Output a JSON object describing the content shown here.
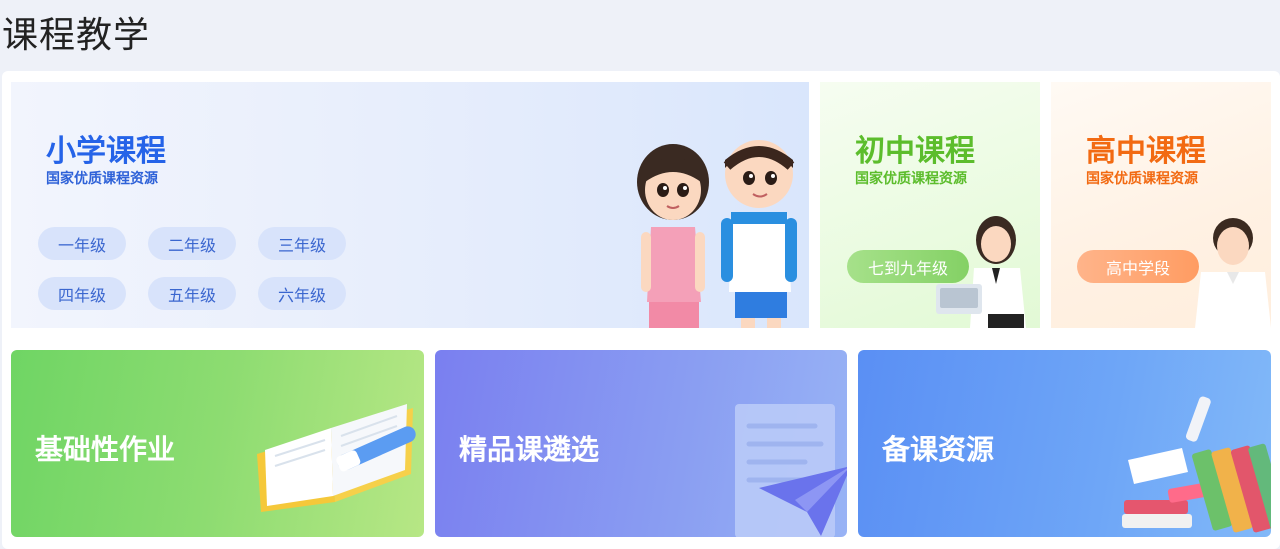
{
  "page": {
    "title": "课程教学"
  },
  "primary": {
    "title": "小学课程",
    "subtitle": "国家优质课程资源",
    "grades": [
      "一年级",
      "二年级",
      "三年级",
      "四年级",
      "五年级",
      "六年级"
    ]
  },
  "junior": {
    "title": "初中课程",
    "subtitle": "国家优质课程资源",
    "button": "七到九年级"
  },
  "senior": {
    "title": "高中课程",
    "subtitle": "国家优质课程资源",
    "button": "高中学段"
  },
  "tiles": [
    {
      "label": "基础性作业",
      "icon": "open-book-pen-icon"
    },
    {
      "label": "精品课遴选",
      "icon": "paper-plane-document-icon"
    },
    {
      "label": "备课资源",
      "icon": "book-stack-icon"
    }
  ],
  "colors": {
    "primary_accent": "#2563e8",
    "junior_accent": "#5cbd2c",
    "senior_accent": "#f26a12"
  }
}
